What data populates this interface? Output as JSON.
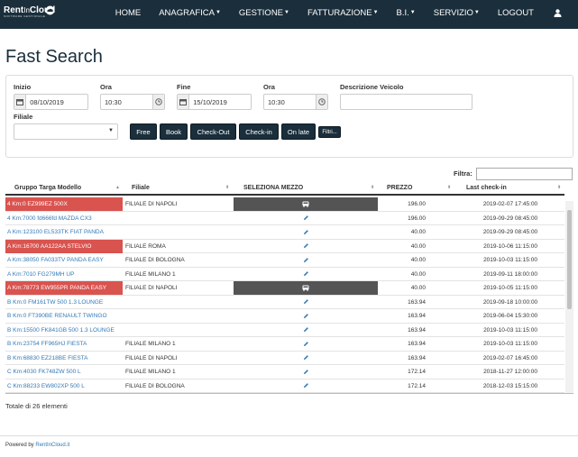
{
  "brand": {
    "name": "Rent",
    "name_in": "In",
    "name_cloud": "Cloud",
    "tagline": "SOFTWARE GESTIONALE"
  },
  "nav": {
    "home": "HOME",
    "anagrafica": "ANAGRAFICA",
    "gestione": "GESTIONE",
    "fatturazione": "FATTURAZIONE",
    "bi": "B.I.",
    "servizio": "SERVIZIO",
    "logout": "LOGOUT",
    "caret": "▼"
  },
  "page": {
    "title": "Fast Search"
  },
  "filters": {
    "inizio_label": "Inizio",
    "inizio_value": "08/10/2019",
    "ora1_label": "Ora",
    "ora1_value": "10:30",
    "fine_label": "Fine",
    "fine_value": "15/10/2019",
    "ora2_label": "Ora",
    "ora2_value": "10:30",
    "descrizione_label": "Descrizione Veicolo",
    "descrizione_value": "",
    "filiale_label": "Filiale",
    "filiale_value": ""
  },
  "buttons": {
    "free": "Free",
    "book": "Book",
    "checkout": "Check-Out",
    "checkin": "Check-in",
    "onlate": "On late",
    "filtri": "Filtri..."
  },
  "table": {
    "filter_label": "Filtra:",
    "columns": {
      "gruppo": "Gruppo Targa Modello",
      "filiale": "Filiale",
      "seleziona": "SELEZIONA MEZZO",
      "prezzo": "PREZZO",
      "lastcheckin": "Last check-in"
    },
    "rows": [
      {
        "gruppo": "4 Km:0 EZ999EZ 500X",
        "filiale": "FILIALE DI NAPOLI",
        "prezzo": "196.00",
        "last": "2019-02-07 17:45:00",
        "red": true,
        "dark": true
      },
      {
        "gruppo": "4 Km:7000 fd666fd MAZDA CX3",
        "filiale": "",
        "prezzo": "196.00",
        "last": "2019-09-29 08:45:00",
        "red": false,
        "dark": false
      },
      {
        "gruppo": "A Km:123100 EL533TK FIAT PANDA",
        "filiale": "",
        "prezzo": "40.00",
        "last": "2019-09-29 08:45:00",
        "red": false,
        "dark": false
      },
      {
        "gruppo": "A Km:16700 AA122AA STELVIO",
        "filiale": "FILIALE ROMA",
        "prezzo": "40.00",
        "last": "2019-10-06 11:15:00",
        "red": true,
        "dark": false
      },
      {
        "gruppo": "A Km:38050 FA033TV PANDA EASY",
        "filiale": "FILIALE DI BOLOGNA",
        "prezzo": "40.00",
        "last": "2019-10-03 11:15:00",
        "red": false,
        "dark": false
      },
      {
        "gruppo": "A Km:7010 FG279MH UP",
        "filiale": "FILIALE MILANO 1",
        "prezzo": "40.00",
        "last": "2019-09-11 18:00:00",
        "red": false,
        "dark": false
      },
      {
        "gruppo": "A Km:78773 EW955PR PANDA EASY",
        "filiale": "FILIALE DI NAPOLI",
        "prezzo": "40.00",
        "last": "2019-10-05 11:15:00",
        "red": true,
        "dark": true
      },
      {
        "gruppo": "B Km:0 FM161TW 500 1.3 LOUNGE",
        "filiale": "",
        "prezzo": "163.94",
        "last": "2019-09-18 10:00:00",
        "red": false,
        "dark": false
      },
      {
        "gruppo": "B Km:0 FT390BE RENAULT TWINGO",
        "filiale": "",
        "prezzo": "163.94",
        "last": "2019-06-04 15:30:00",
        "red": false,
        "dark": false
      },
      {
        "gruppo": "B Km:15500 FK841GB 500 1.3 LOUNGE",
        "filiale": "",
        "prezzo": "163.94",
        "last": "2019-10-03 11:15:00",
        "red": false,
        "dark": false
      },
      {
        "gruppo": "B Km:23754 FF965HJ FIESTA",
        "filiale": "FILIALE MILANO 1",
        "prezzo": "163.94",
        "last": "2019-10-03 11:15:00",
        "red": false,
        "dark": false
      },
      {
        "gruppo": "B Km:68830 EZ218BE FIESTA",
        "filiale": "FILIALE DI NAPOLI",
        "prezzo": "163.94",
        "last": "2019-02-07 16:45:00",
        "red": false,
        "dark": false
      },
      {
        "gruppo": "C Km:4030 FK748ZW 500 L",
        "filiale": "FILIALE MILANO 1",
        "prezzo": "172.14",
        "last": "2018-11-27 12:00:00",
        "red": false,
        "dark": false
      },
      {
        "gruppo": "C Km:88233 EW802XP 500 L",
        "filiale": "FILIALE DI BOLOGNA",
        "prezzo": "172.14",
        "last": "2018-12-03 15:15:00",
        "red": false,
        "dark": false
      }
    ]
  },
  "summary": {
    "total": "Totale di 26 elementi"
  },
  "footer": {
    "prefix": "Powered by ",
    "link": "RentInCloud.it"
  },
  "colors": {
    "navbar": "#1a2e3b",
    "red_row": "#d9534f",
    "link": "#337ab7",
    "dark_cell": "#545454"
  }
}
